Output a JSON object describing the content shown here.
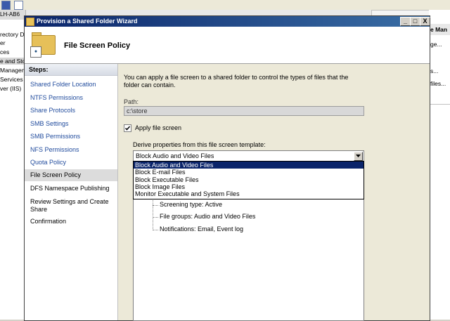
{
  "background": {
    "left_items": [
      "rectory D",
      "er",
      "ces",
      "e and Sto",
      "Managem",
      "Services",
      "ver (IIS)"
    ],
    "left_partial_title": "LH-AB6",
    "right_header": "e Man",
    "right_items": [
      "ge...",
      "s...",
      "files..."
    ]
  },
  "wizard": {
    "title": "Provision a Shared Folder Wizard",
    "buttons": {
      "minimize": "_",
      "maximize": "□",
      "close": "X"
    },
    "page_title": "File Screen Policy",
    "steps_header": "Steps:",
    "steps": [
      "Shared Folder Location",
      "NTFS Permissions",
      "Share Protocols",
      "SMB Settings",
      "SMB Permissions",
      "NFS Permissions",
      "Quota Policy",
      "File Screen Policy",
      "DFS Namespace Publishing",
      "Review Settings and Create Share",
      "Confirmation"
    ],
    "active_step": "File Screen Policy",
    "description": "You can apply a file screen to a shared folder to control the types of files that the folder can contain.",
    "path_label": "Path:",
    "path_value": "c:\\store",
    "apply_label": "Apply file screen",
    "apply_checked": true,
    "derive_label": "Derive properties from this file screen template:",
    "template_selected": "Block Audio and Video Files",
    "template_options": [
      "Block Audio and Video Files",
      "Block E-mail Files",
      "Block Executable Files",
      "Block Image Files",
      "Monitor Executable and System Files"
    ],
    "summary": {
      "screening_type": "Screening type: Active",
      "file_groups": "File groups: Audio and Video Files",
      "notifications": "Notifications: Email, Event log"
    }
  },
  "colors": {
    "title_bar": "#0a246a",
    "link": "#1f4a9c",
    "highlight": "#0a246a"
  }
}
